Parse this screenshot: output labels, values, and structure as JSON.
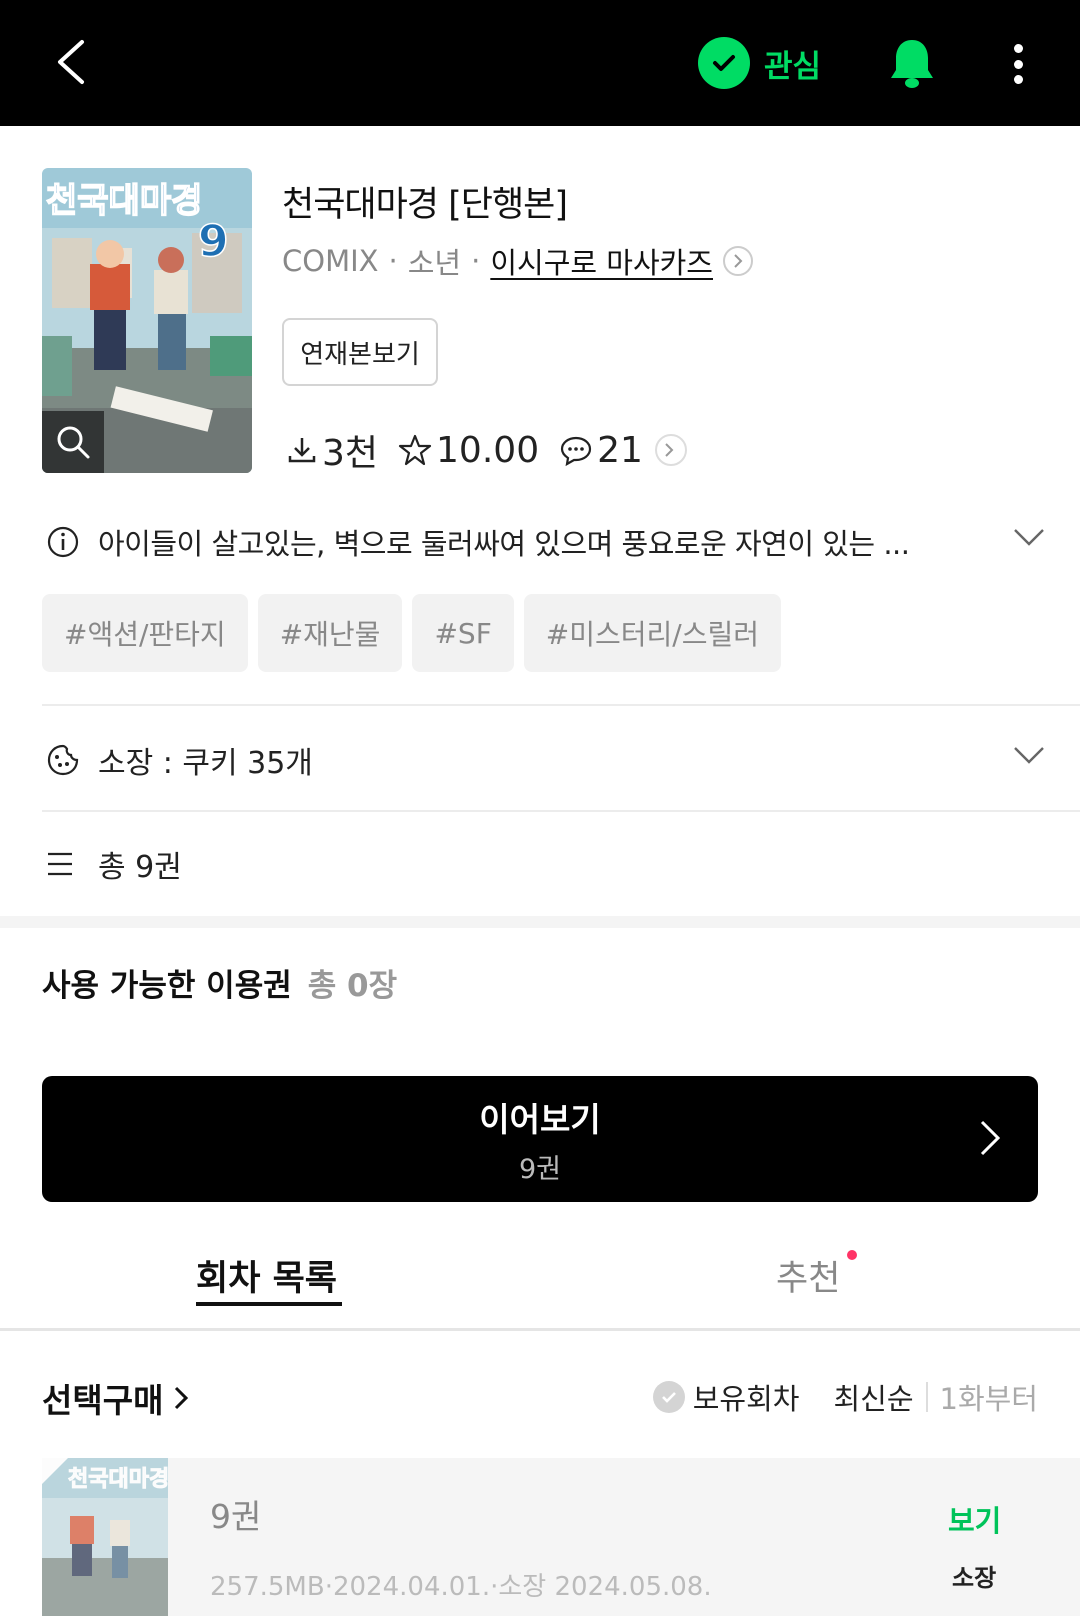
{
  "header": {
    "favorite_label": "관심",
    "accent": "#00dc64"
  },
  "book": {
    "title": "천국대마경 [단행본]",
    "publisher": "COMIX",
    "genre": "소년",
    "author": "이시구로 마사카즈",
    "cover_text": "천국대마경",
    "cover_volume": "9",
    "serial_button": "연재본보기",
    "downloads": "3천",
    "rating": "10.00",
    "comments": "21"
  },
  "synopsis": "아이들이 살고있는, 벽으로 둘러싸여 있으며 풍요로운 자연이 있는 ...",
  "tags": [
    "#액션/판타지",
    "#재난물",
    "#SF",
    "#미스터리/스릴러"
  ],
  "ownership": "소장 : 쿠키 35개",
  "total": "총 9권",
  "pass": {
    "label": "사용 가능한 이용권",
    "count": "총 0장"
  },
  "continue": {
    "label": "이어보기",
    "volume": "9권"
  },
  "tabs": {
    "episodes": "회차 목록",
    "recommend": "추천"
  },
  "list_controls": {
    "select_buy": "선택구매",
    "owned": "보유회차",
    "latest": "최신순",
    "from_first": "1화부터"
  },
  "episodes": [
    {
      "title": "9권",
      "meta": "257.5MB·2024.04.01.·소장 2024.05.08.",
      "view": "보기",
      "status": "소장"
    }
  ]
}
